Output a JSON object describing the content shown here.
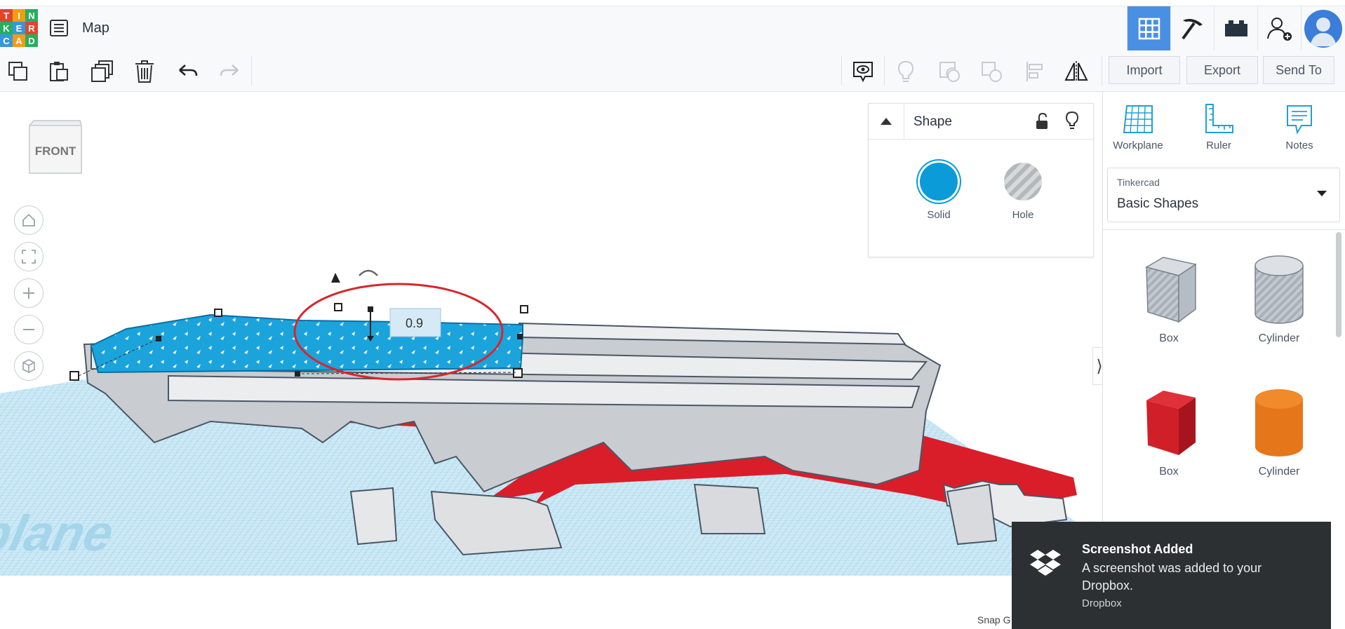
{
  "app": {
    "logo_letters": [
      "T",
      "I",
      "N",
      "K",
      "E",
      "R",
      "C",
      "A",
      "D"
    ],
    "logo_colors": [
      "#e2442f",
      "#f39c12",
      "#27ae60",
      "#3498db",
      "#e2442f",
      "#f39c12",
      "#27ae60",
      "#3498db",
      "#e2442f"
    ],
    "design_title": "Map"
  },
  "topbar": {
    "buttons": [
      "grid-view-icon",
      "pickaxe-icon",
      "bricks-icon",
      "invite-user-icon"
    ],
    "accent": "#4a90e2"
  },
  "toolbar": {
    "left_tools": [
      "copy-icon",
      "paste-icon",
      "duplicate-icon",
      "delete-icon",
      "undo-icon",
      "redo-icon"
    ],
    "right_tools": [
      "show-icon",
      "light-bulb-icon",
      "group-icon",
      "ungroup-icon",
      "align-icon",
      "mirror-icon"
    ],
    "import_label": "Import",
    "export_label": "Export",
    "send_to_label": "Send To"
  },
  "viewport": {
    "viewcube_label": "FRONT",
    "dimension_value": "0.9",
    "workplane_watermark": "orkplane",
    "snap_label": "Snap G",
    "nav_buttons": [
      "home-icon",
      "fit-view-icon",
      "zoom-in-icon",
      "zoom-out-icon",
      "perspective-icon"
    ]
  },
  "inspector": {
    "title": "Shape",
    "solid_label": "Solid",
    "hole_label": "Hole",
    "solid_color": "#0a9bd8"
  },
  "panel": {
    "workplane_label": "Workplane",
    "ruler_label": "Ruler",
    "notes_label": "Notes",
    "library_source": "Tinkercad",
    "library_name": "Basic Shapes",
    "shapes": [
      {
        "label": "Box",
        "color": "#b7bec7"
      },
      {
        "label": "Cylinder",
        "color": "#b7bec7"
      },
      {
        "label": "Box",
        "color": "#d91e2a"
      },
      {
        "label": "Cylinder",
        "color": "#e87817"
      }
    ]
  },
  "toast": {
    "title": "Screenshot Added",
    "message": "A screenshot was added to your Dropbox.",
    "source": "Dropbox"
  }
}
